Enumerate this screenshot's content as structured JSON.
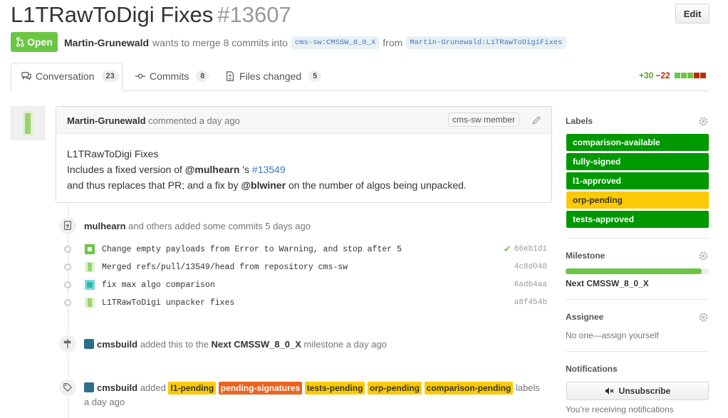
{
  "header": {
    "title": "L1TRawToDigi Fixes",
    "number": "#13607",
    "edit_label": "Edit",
    "state_label": "Open",
    "author": "Martin-Grunewald",
    "merge_text": "wants to merge 8 commits into",
    "base_ref": "cms-sw:CMSSW_8_0_X",
    "from_text": "from",
    "head_ref": "Martin-Grunewald:L1TRawToDigiFixes"
  },
  "tabs": [
    {
      "label": "Conversation",
      "count": "23",
      "icon": "comment-discussion-icon"
    },
    {
      "label": "Commits",
      "count": "8",
      "icon": "git-commit-icon"
    },
    {
      "label": "Files changed",
      "count": "5",
      "icon": "file-diff-icon"
    }
  ],
  "diffstat": {
    "additions": "+30",
    "deletions": "−22",
    "blocks": [
      "green",
      "green",
      "green",
      "red",
      "red",
      "grey"
    ]
  },
  "comment": {
    "author": "Martin-Grunewald",
    "action": "commented a day ago",
    "role": "cms-sw member",
    "line1": "L1TRawToDigi Fixes",
    "line2_pre": "Includes a fixed version of",
    "line2_user": "@mulhearn",
    "line2_mid": "'s",
    "line2_link": "#13549",
    "line3_pre": "and thus replaces that PR; and a fix by",
    "line3_user": "@blwiner",
    "line3_post": "on the number of algos being unpacked."
  },
  "timeline": {
    "commits_event": {
      "user": "mulhearn",
      "text": "and others added some commits 5 days ago"
    },
    "commits": [
      {
        "message": "Change empty payloads from Error to Warning, and stop after 5",
        "sha": "66eb1d1",
        "verified": true,
        "avatar": "green-identicon"
      },
      {
        "message": "Merged refs/pull/13549/head from repository cms-sw",
        "sha": "4c8d048",
        "verified": false,
        "avatar": "lime-identicon"
      },
      {
        "message": "fix max algo comparison",
        "sha": "6adb4aa",
        "verified": false,
        "avatar": "teal-identicon"
      },
      {
        "message": "L1TRawToDigi unpacker fixes",
        "sha": "a8f454b",
        "verified": false,
        "avatar": "lime-identicon"
      }
    ],
    "milestone_event": {
      "user": "cmsbuild",
      "pre": "added this to the",
      "milestone": "Next CMSSW_8_0_X",
      "post": "milestone a day ago"
    },
    "labels_event": {
      "user": "cmsbuild",
      "pre": "added",
      "labels": [
        {
          "name": "l1-pending",
          "color": "#fbca04",
          "white": false
        },
        {
          "name": "pending-signatures",
          "color": "#eb6420",
          "white": true
        },
        {
          "name": "tests-pending",
          "color": "#fbca04",
          "white": false
        },
        {
          "name": "orp-pending",
          "color": "#fbca04",
          "white": false
        },
        {
          "name": "comparison-pending",
          "color": "#fbca04",
          "white": false
        }
      ],
      "post": "labels",
      "time": "a day ago"
    }
  },
  "sidebar": {
    "labels_heading": "Labels",
    "labels": [
      {
        "name": "comparison-available",
        "color": "#009800",
        "white": true
      },
      {
        "name": "fully-signed",
        "color": "#009800",
        "white": true
      },
      {
        "name": "l1-approved",
        "color": "#009800",
        "white": true
      },
      {
        "name": "orp-pending",
        "color": "#fbca04",
        "white": false
      },
      {
        "name": "tests-approved",
        "color": "#009800",
        "white": true
      }
    ],
    "milestone_heading": "Milestone",
    "milestone_progress": 0.95,
    "milestone_name": "Next CMSSW_8_0_X",
    "assignee_heading": "Assignee",
    "assignee_text": "No one—assign yourself",
    "notifications_heading": "Notifications",
    "unsubscribe_label": "Unsubscribe",
    "notifications_text": "You’re receiving notifications"
  },
  "colors": {
    "accent_green": "#6cc644",
    "link": "#4078c0",
    "label_green": "#009800",
    "label_yellow": "#fbca04",
    "label_orange": "#eb6420"
  }
}
